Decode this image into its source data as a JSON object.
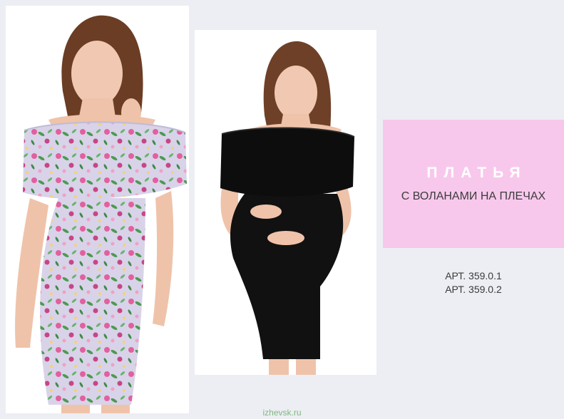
{
  "promo": {
    "title": "ПЛАТЬЯ",
    "subtitle": "С ВОЛАНАМИ НА ПЛЕЧАХ",
    "background": "#f8c8ec"
  },
  "articles": [
    {
      "label": "АРТ. 359.0.1"
    },
    {
      "label": "АРТ. 359.0.2"
    }
  ],
  "photos": [
    {
      "name": "floral-dress-photo",
      "dress_color": "#d6d2e6",
      "accent": "#e05a9c"
    },
    {
      "name": "black-dress-photo",
      "dress_color": "#111111"
    }
  ],
  "watermark": "izhevsk.ru"
}
